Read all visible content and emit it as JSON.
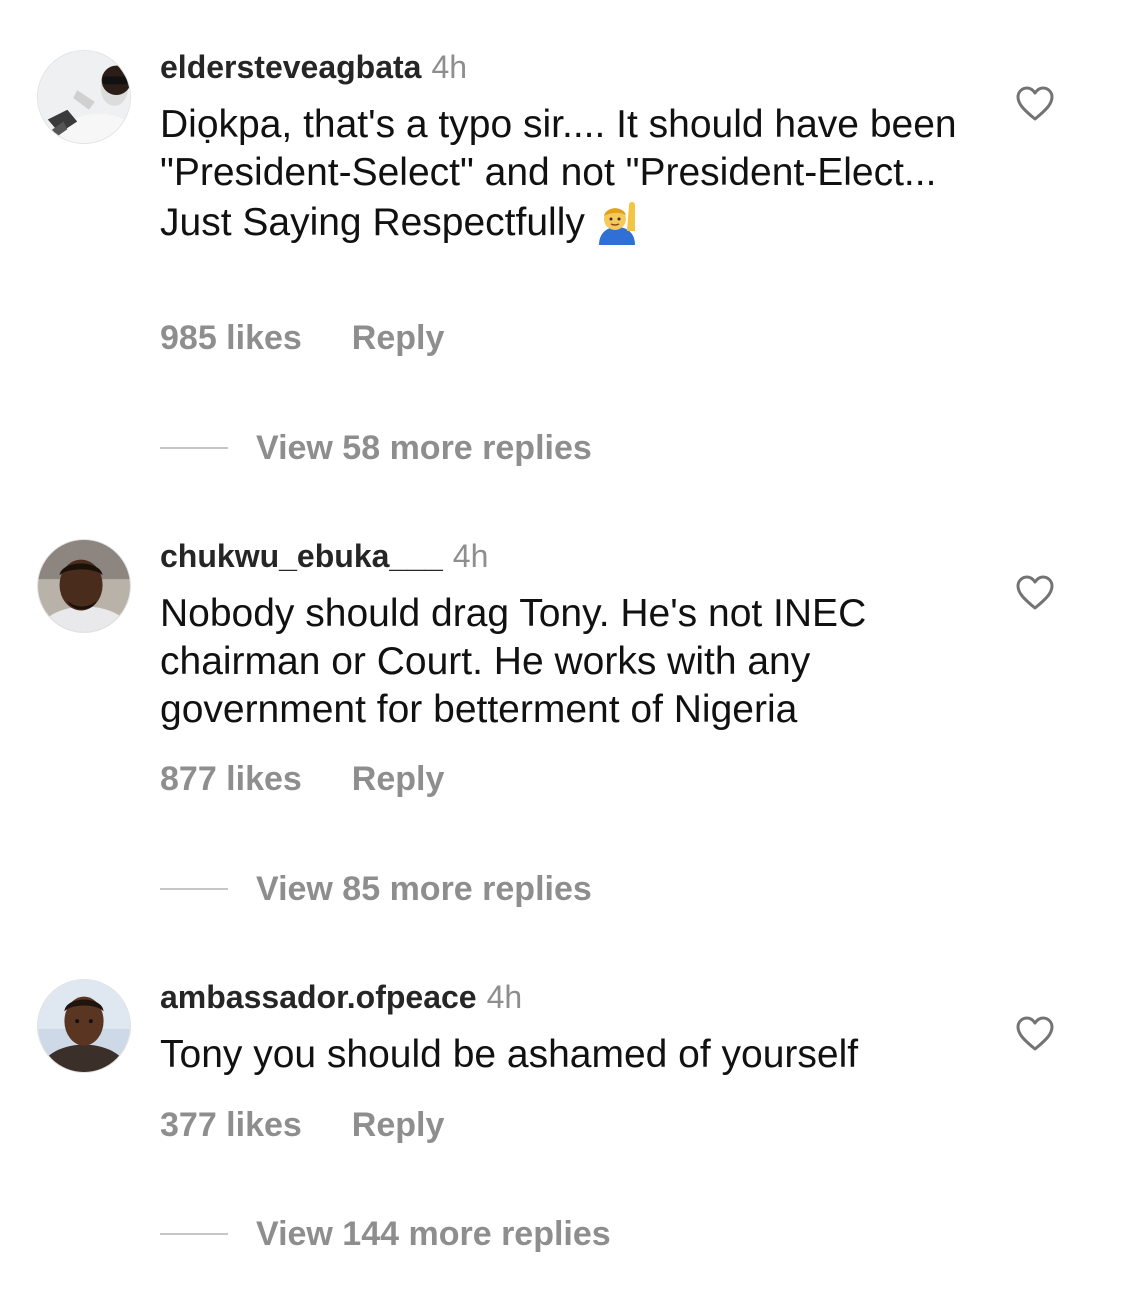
{
  "comments": [
    {
      "username": "eldersteveagbata",
      "time": "4h",
      "text": "Diọkpa, that's a typo sir.... It should have been \"President-Select\" and not \"President-Elect... Just Saying Respectfully",
      "emoji": "raising-hand-emoji",
      "likes": "985 likes",
      "reply": "Reply",
      "view_replies": "View 58 more replies",
      "avatar_icon": "user-avatar-icon"
    },
    {
      "username": "chukwu_ebuka___",
      "time": "4h",
      "text": "Nobody should drag Tony. He's not INEC chairman or Court. He works with any government for betterment of Nigeria",
      "likes": "877 likes",
      "reply": "Reply",
      "view_replies": "View 85 more replies",
      "avatar_icon": "user-avatar-icon"
    },
    {
      "username": "ambassador.ofpeace",
      "time": "4h",
      "text": "Tony you should be ashamed of yourself",
      "likes": "377 likes",
      "reply": "Reply",
      "view_replies": "View 144 more replies",
      "avatar_icon": "user-avatar-icon"
    }
  ],
  "colors": {
    "text": "#111111",
    "muted": "#8e8e8e",
    "username": "#262626",
    "divider": "#c7c7c7"
  },
  "icons": {
    "like": "heart-outline-icon"
  }
}
